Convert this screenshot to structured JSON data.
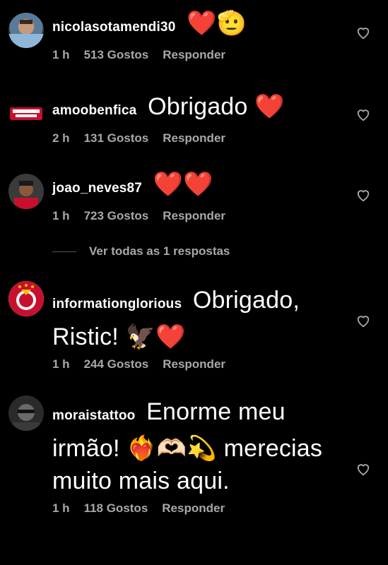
{
  "comments": [
    {
      "username": "nicolasotamendi30",
      "text": "",
      "emojis": "❤️🫡",
      "time": "1 h",
      "likes": "513 Gostos",
      "reply": "Responder"
    },
    {
      "username": "amoobenfica",
      "text": "Obrigado",
      "emojis": "❤️",
      "time": "2 h",
      "likes": "131 Gostos",
      "reply": "Responder"
    },
    {
      "username": "joao_neves87",
      "text": "",
      "emojis": "❤️❤️",
      "time": "1 h",
      "likes": "723 Gostos",
      "reply": "Responder"
    },
    {
      "username": "informationglorious",
      "text": "Obrigado, Ristic!",
      "emojis": "🦅❤️",
      "time": "1 h",
      "likes": "244 Gostos",
      "reply": "Responder"
    },
    {
      "username": "moraistattoo",
      "text": "Enorme meu irmão!",
      "emojis": "❤️‍🔥🫶🏻💫",
      "text2": "merecias muito mais aqui.",
      "time": "1 h",
      "likes": "118 Gostos",
      "reply": "Responder"
    }
  ],
  "view_replies": "Ver todas as 1 respostas",
  "icons": {
    "like": "heart-outline-icon"
  },
  "colors": {
    "background": "#000000",
    "meta": "#a8a8a8",
    "heart": "#e0201f"
  }
}
